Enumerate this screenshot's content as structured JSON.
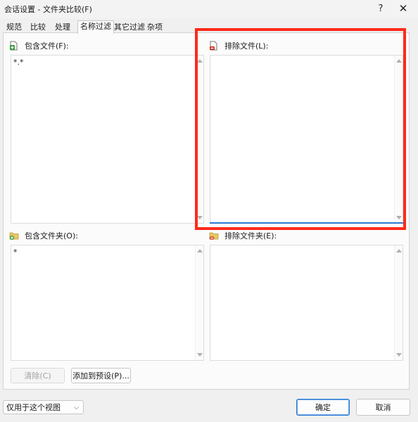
{
  "window": {
    "title": "会话设置 - 文件夹比较(F)",
    "help_glyph": "?",
    "close_glyph": "✕"
  },
  "tabs": [
    {
      "label": "规范"
    },
    {
      "label": "比较"
    },
    {
      "label": "处理"
    },
    {
      "label": "名称过滤",
      "active": true
    },
    {
      "label": "其它过滤"
    },
    {
      "label": "杂项"
    }
  ],
  "filters": {
    "include_files": {
      "label": "包含文件(F):",
      "value": "*.*"
    },
    "exclude_files": {
      "label": "排除文件(L):",
      "value": ""
    },
    "include_folders": {
      "label": "包含文件夹(O):",
      "value": "*"
    },
    "exclude_folders": {
      "label": "排除文件夹(E):",
      "value": ""
    }
  },
  "actions": {
    "clear_label": "清除(C)",
    "add_preset_label": "添加到预设(P)..."
  },
  "footer": {
    "scope_select_value": "仅用于这个视图",
    "ok_label": "确定",
    "cancel_label": "取消"
  },
  "colors": {
    "highlight": "#ff2a1a",
    "focus": "#2b7cd3",
    "include_icon": "#3a9a3a",
    "exclude_icon": "#d03020"
  },
  "icons": {
    "include_files": "file-plus-icon",
    "exclude_files": "file-minus-icon",
    "include_folders": "folder-plus-icon",
    "exclude_folders": "folder-minus-icon"
  }
}
